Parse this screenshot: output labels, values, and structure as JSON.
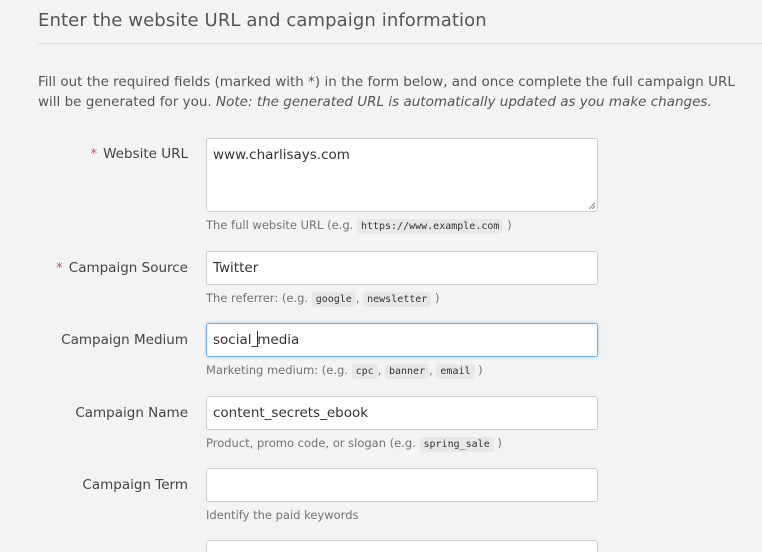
{
  "section": {
    "title": "Enter the website URL and campaign information",
    "intro": "Fill out the required fields (marked with *) in the form below, and once complete the full campaign URL will be generated for you.",
    "intro_note": "Note: the generated URL is automatically updated as you make changes."
  },
  "fields": {
    "website_url": {
      "required_mark": "*",
      "label": "Website URL",
      "value": "www.charlisays.com",
      "help_prefix": "The full website URL (e.g.",
      "examples": [
        "https://www.example.com"
      ],
      "help_suffix": ")"
    },
    "campaign_source": {
      "required_mark": "*",
      "label": "Campaign Source",
      "value": "Twitter",
      "help_prefix": "The referrer: (e.g.",
      "examples": [
        "google",
        "newsletter"
      ],
      "help_suffix": ")"
    },
    "campaign_medium": {
      "label": "Campaign Medium",
      "value_before_caret": "social_",
      "value_after_caret": "media",
      "help_prefix": "Marketing medium: (e.g.",
      "examples": [
        "cpc",
        "banner",
        "email"
      ],
      "help_suffix": ")"
    },
    "campaign_name": {
      "label": "Campaign Name",
      "value": "content_secrets_ebook",
      "help_prefix": "Product, promo code, or slogan (e.g.",
      "examples": [
        "spring_sale"
      ],
      "help_suffix": ")"
    },
    "campaign_term": {
      "label": "Campaign Term",
      "value": "",
      "help": "Identify the paid keywords"
    },
    "campaign_content": {
      "value": ""
    }
  },
  "colors": {
    "background": "#f3f3f3",
    "required": "#d9534f",
    "focus_border": "#66afe9"
  }
}
